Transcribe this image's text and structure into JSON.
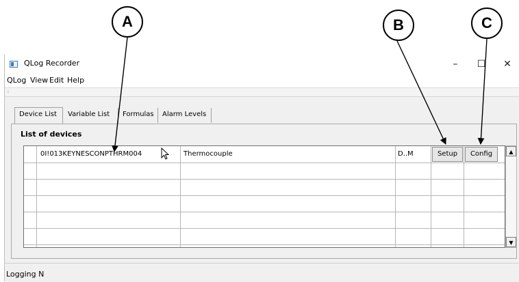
{
  "callouts": [
    "A",
    "B",
    "C"
  ],
  "window": {
    "title": "QLog Recorder",
    "minimize_glyph": "–",
    "maximize_glyph": "☐",
    "close_glyph": "✕"
  },
  "menu": [
    "QLog",
    "View",
    "Edit",
    "Help"
  ],
  "toolbar": {
    "grip": "::"
  },
  "tabs": [
    {
      "label": "Device List",
      "active": true
    },
    {
      "label": "Variable List",
      "active": false
    },
    {
      "label": "Formulas",
      "active": false
    },
    {
      "label": "Alarm Levels",
      "active": false
    }
  ],
  "device_list": {
    "section_label": "List of devices",
    "rows": [
      {
        "device_id": "0I!013KEYNESCONPTHRM004",
        "type": "Thermocouple",
        "mode": "D..M",
        "setup_label": "Setup",
        "config_label": "Config"
      }
    ],
    "scroll_up": "▲",
    "scroll_down": "▼"
  },
  "status": {
    "text": "Logging N"
  },
  "colors": {
    "window_bg": "#f0f0f0",
    "grid_bg": "#ffffff",
    "grid_lines": "#b5b5b5"
  }
}
